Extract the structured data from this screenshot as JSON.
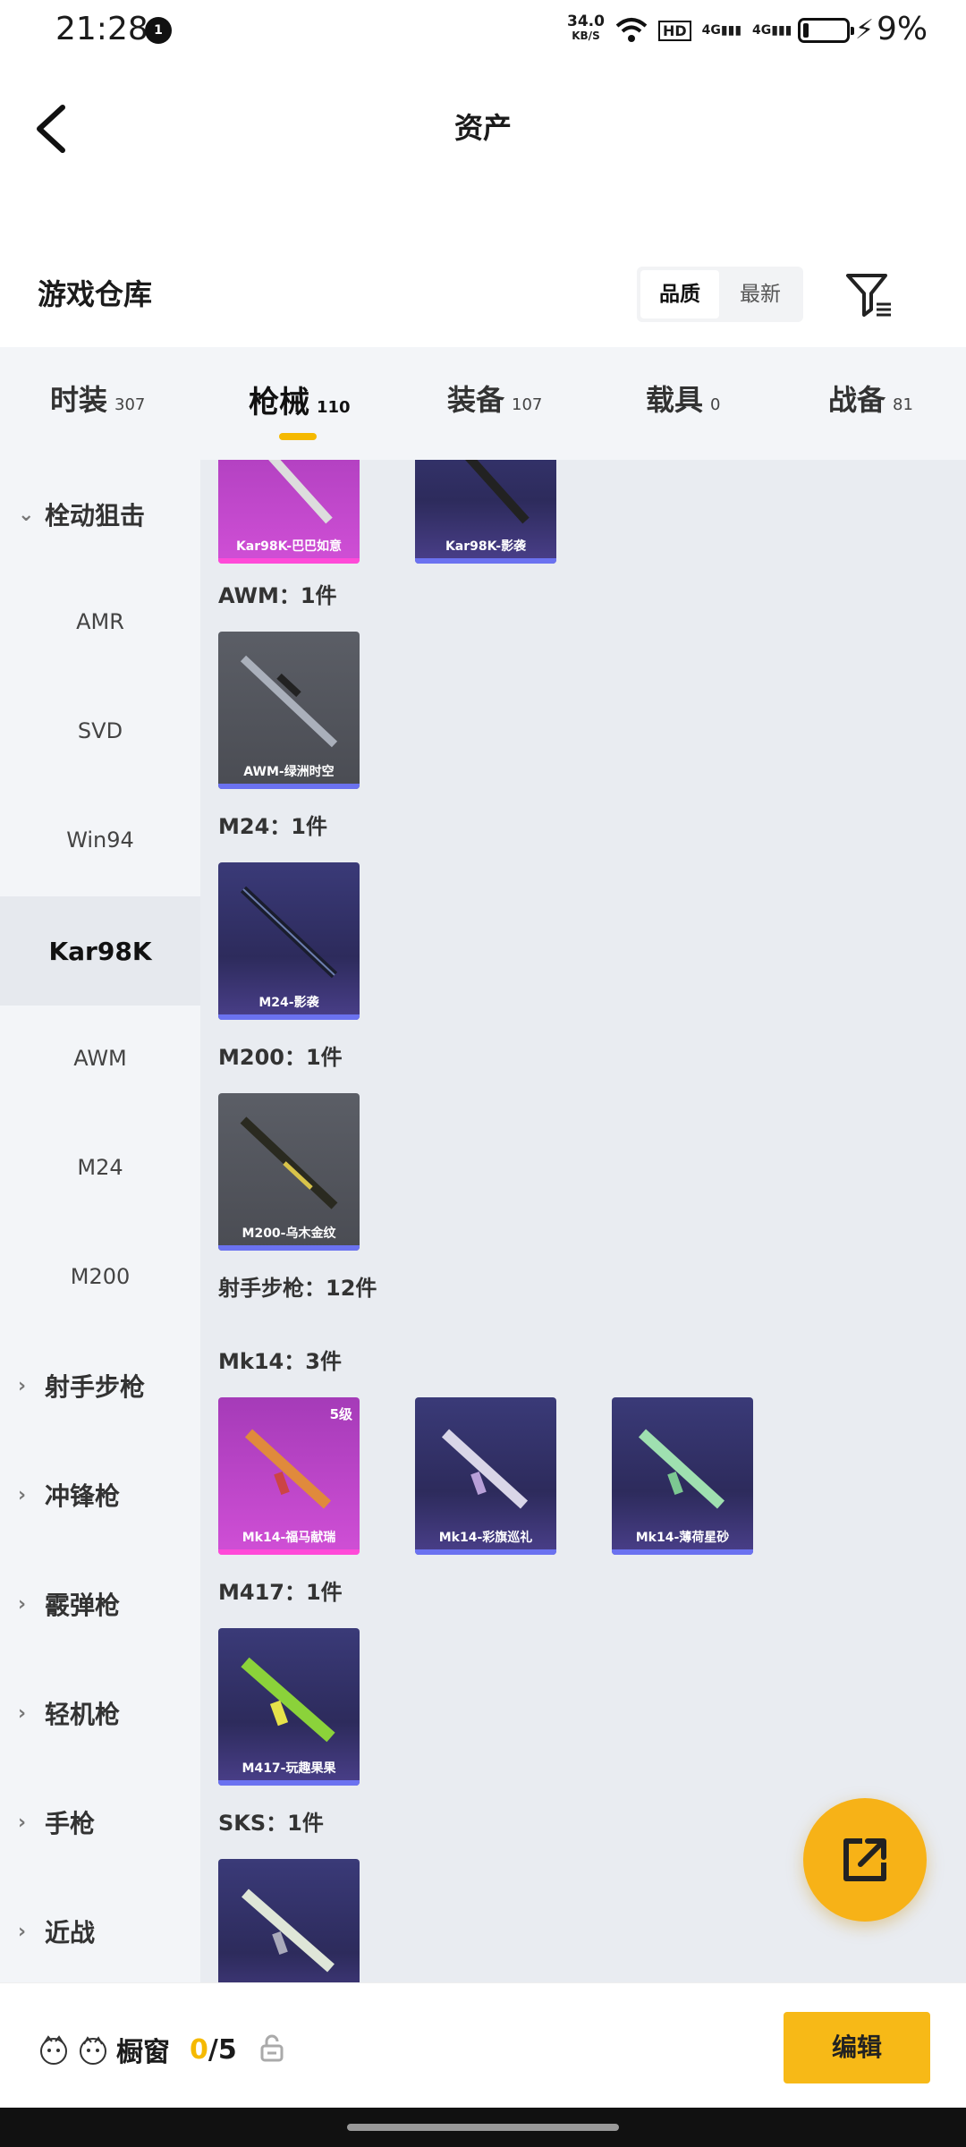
{
  "status": {
    "time": "21:28",
    "notification_count": "1",
    "net_speed": "34.0",
    "net_unit": "KB/S",
    "hd": "HD",
    "signal1": "4G",
    "signal2": "4G",
    "battery": "9%"
  },
  "header": {
    "title": "资产"
  },
  "section": {
    "title": "游戏仓库",
    "sort_quality": "品质",
    "sort_latest": "最新"
  },
  "tabs": [
    {
      "label": "时装",
      "count": "307"
    },
    {
      "label": "枪械",
      "count": "110"
    },
    {
      "label": "装备",
      "count": "107"
    },
    {
      "label": "载具",
      "count": "0"
    },
    {
      "label": "战备",
      "count": "81"
    }
  ],
  "sidebar": {
    "categories": [
      "栓动狙击",
      "射手步枪",
      "冲锋枪",
      "霰弹枪",
      "轻机枪",
      "手枪",
      "近战"
    ],
    "items": [
      "AMR",
      "SVD",
      "Win94",
      "Kar98K",
      "AWM",
      "M24",
      "M200"
    ],
    "selected": "Kar98K"
  },
  "content": {
    "top_cards": [
      "Kar98K-巴巴如意",
      "Kar98K-影袭"
    ],
    "groups": [
      {
        "label": "AWM：1件",
        "cards": [
          "AWM-绿洲时空"
        ]
      },
      {
        "label": "M24：1件",
        "cards": [
          "M24-影袭"
        ]
      },
      {
        "label": "M200：1件",
        "cards": [
          "M200-乌木金纹"
        ]
      },
      {
        "label": "射手步枪：12件"
      },
      {
        "label": "Mk14：3件",
        "cards": [
          "Mk14-福马献瑞",
          "Mk14-彩旗巡礼",
          "Mk14-薄荷星砂"
        ],
        "level": "5级"
      },
      {
        "label": "M417：1件",
        "cards": [
          "M417-玩趣果果"
        ]
      },
      {
        "label": "SKS：1件"
      }
    ]
  },
  "bottom": {
    "showcase_label": "橱窗",
    "count_current": "0",
    "count_total": "/5",
    "edit_label": "编辑"
  },
  "colors": {
    "accent": "#f5b900",
    "purple_card": "#2d2b5c",
    "pink_card": "#c646cf"
  }
}
